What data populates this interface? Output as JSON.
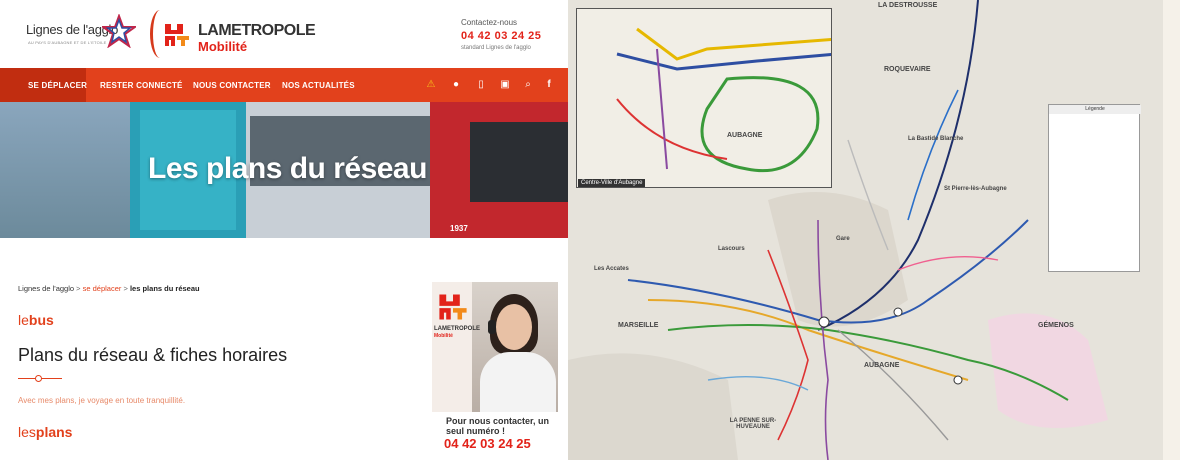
{
  "header": {
    "agglo_logo": "Lignes de l'agglo",
    "agglo_tagline": "AU PAYS D'AUBAGNE ET DE L'ETOILE",
    "metropole_line1": "LAMETROPOLE",
    "metropole_line2": "Mobilité",
    "contact_label": "Contactez-nous",
    "contact_phone": "04 42 03 24 25",
    "contact_sub": "standard Lignes de l'agglo"
  },
  "nav": {
    "items": [
      "SE DÉPLACER",
      "RESTER CONNECTÉ",
      "NOUS CONTACTER",
      "NOS ACTUALITÉS"
    ],
    "icons": [
      "warning-icon",
      "chat-icon",
      "mobile-icon",
      "bus-icon",
      "search-icon",
      "facebook-icon"
    ]
  },
  "hero": {
    "title": "Les plans du réseau",
    "bus_number": "1937"
  },
  "breadcrumb": {
    "home": "Lignes de l'agglo",
    "section": "se déplacer",
    "current": "les plans du réseau"
  },
  "content": {
    "kicker1_light": "le",
    "kicker1_bold": "bus",
    "heading": "Plans du réseau & fiches horaires",
    "intro": "Avec mes plans, je voyage en toute tranquillité.",
    "kicker2_light": "les",
    "kicker2_bold": "plans"
  },
  "ad": {
    "logo_line1": "LAMETROPOLE",
    "logo_line2": "Mobilité",
    "cta_text": "Pour nous contacter, un seul numéro !",
    "cta_phone": "04 42 03 24 25"
  },
  "map": {
    "inset_label": "Centre-Ville d'Aubagne",
    "legend_title": "Légende",
    "places": [
      "LA DESTROUSSE",
      "ROQUEVAIRE",
      "AUBAGNE",
      "MARSEILLE",
      "GÉMENOS",
      "LA PENNE SUR-HUVEAUNE",
      "Gare",
      "Les Accates",
      "St Pierre-lès-Aubagne",
      "La Bastide Blanche",
      "Lascours"
    ]
  },
  "colors": {
    "accent": "#e2411c",
    "brand_red": "#e2231a"
  }
}
